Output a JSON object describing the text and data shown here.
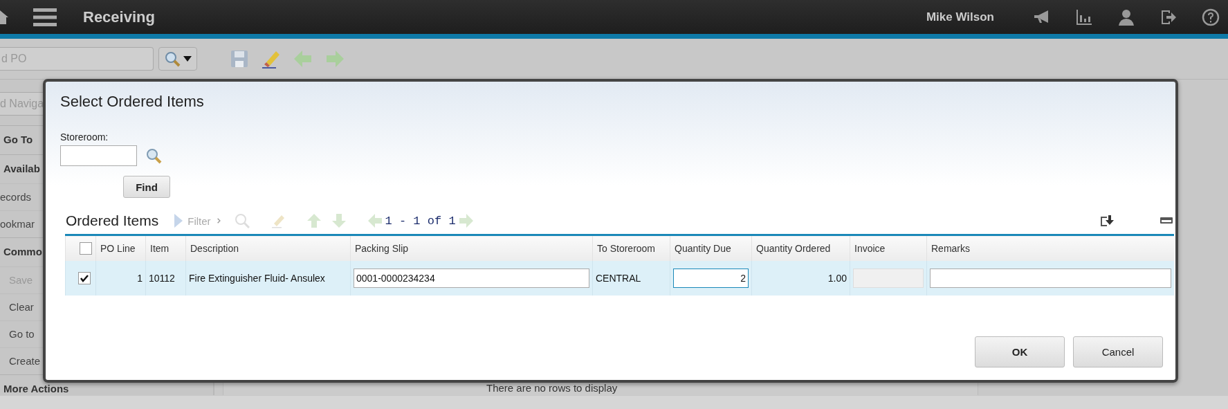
{
  "header": {
    "title": "Receiving",
    "user": "Mike Wilson"
  },
  "toolbar": {
    "search_placeholder": "d PO"
  },
  "sidebar": {
    "search_placeholder": "d Naviga",
    "sections": [
      {
        "title": "Go To"
      },
      {
        "title": "Availab",
        "items": [
          {
            "label": "ecords",
            "disabled": false
          },
          {
            "label": "ookmar",
            "disabled": false
          }
        ]
      },
      {
        "title": "Commo",
        "items": [
          {
            "label": "Save",
            "disabled": true
          },
          {
            "label": "Clear",
            "disabled": false
          },
          {
            "label": "Go to",
            "disabled": false
          },
          {
            "label": "Create",
            "disabled": false
          }
        ]
      },
      {
        "title": "More Actions"
      }
    ]
  },
  "content": {
    "message": "There are no rows to display"
  },
  "dialog": {
    "title": "Select Ordered Items",
    "storeroom_label": "Storeroom:",
    "find_button": "Find",
    "table": {
      "title": "Ordered Items",
      "filter_label": "Filter",
      "pagination": "1 - 1 of 1",
      "select_all_checked": false,
      "columns": [
        "PO Line",
        "Item",
        "Description",
        "Packing Slip",
        "To Storeroom",
        "Quantity Due",
        "Quantity Ordered",
        "Invoice",
        "Remarks"
      ],
      "rows": [
        {
          "selected": true,
          "checked": true,
          "cells": [
            {
              "kind": "text",
              "value": "1"
            },
            {
              "kind": "text",
              "value": "10112"
            },
            {
              "kind": "text",
              "value": "Fire Extinguisher Fluid- Ansulex"
            },
            {
              "kind": "field",
              "value": "0001-0000234234",
              "focused": false
            },
            {
              "kind": "text",
              "value": "CENTRAL"
            },
            {
              "kind": "field",
              "value": "2",
              "focused": true
            },
            {
              "kind": "text",
              "value": "1.00"
            },
            {
              "kind": "readonly_field"
            },
            {
              "kind": "field",
              "focused": false
            }
          ]
        }
      ]
    },
    "buttons": [
      {
        "label": "OK",
        "default": true
      },
      {
        "label": "Cancel",
        "default": false
      }
    ]
  }
}
